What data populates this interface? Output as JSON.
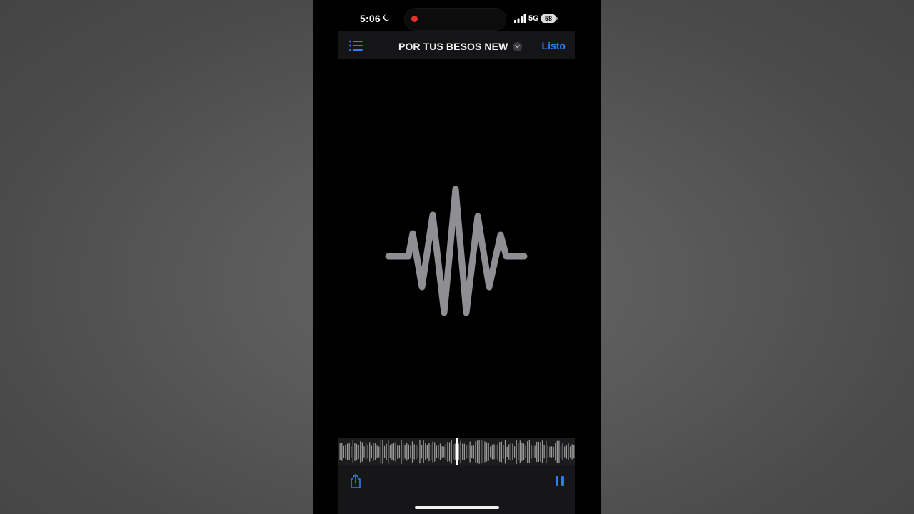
{
  "status_bar": {
    "time": "5:06",
    "network": "5G",
    "battery": "58",
    "icons": [
      "moon-icon",
      "recording-indicator",
      "signal-icon",
      "battery-icon"
    ]
  },
  "nav": {
    "title": "POR TUS BESOS NEW",
    "done_label": "Listo",
    "icons": [
      "list-icon",
      "chevron-down-icon"
    ]
  },
  "toolbar": {
    "icons": [
      "share-icon",
      "pause-icon"
    ]
  },
  "colors": {
    "accent": "#2f7cf6",
    "recording": "#e0342a",
    "waveform": "#8e8e93",
    "background": "#000000"
  }
}
